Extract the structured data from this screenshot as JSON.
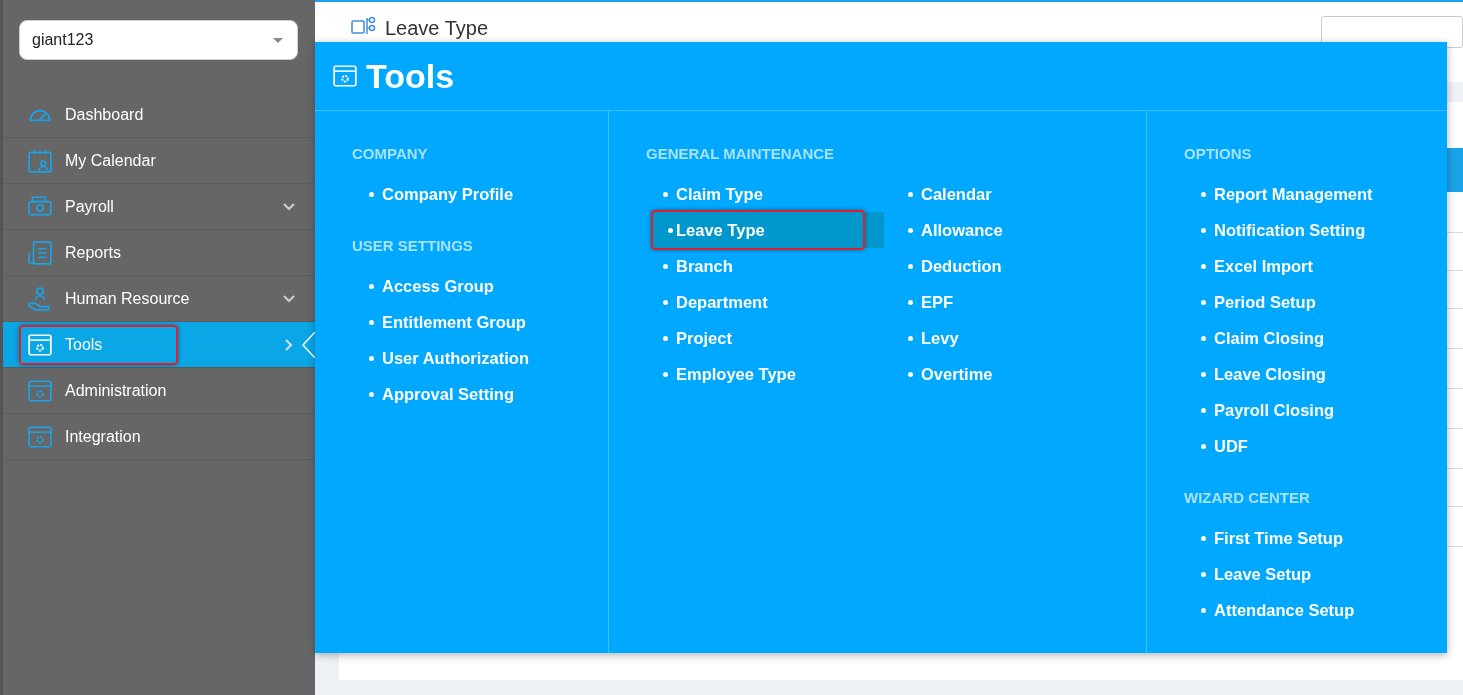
{
  "company_select": {
    "value": "giant123"
  },
  "sidebar": {
    "items": [
      {
        "label": "Dashboard",
        "expandable": false,
        "selected": false,
        "highlighted": false
      },
      {
        "label": "My Calendar",
        "expandable": false,
        "selected": false,
        "highlighted": false
      },
      {
        "label": "Payroll",
        "expandable": true,
        "selected": false,
        "highlighted": false
      },
      {
        "label": "Reports",
        "expandable": false,
        "selected": false,
        "highlighted": false
      },
      {
        "label": "Human Resource",
        "expandable": true,
        "selected": false,
        "highlighted": false
      },
      {
        "label": "Tools",
        "expandable": false,
        "selected": true,
        "highlighted": true
      },
      {
        "label": "Administration",
        "expandable": false,
        "selected": false,
        "highlighted": false
      },
      {
        "label": "Integration",
        "expandable": false,
        "selected": false,
        "highlighted": false
      }
    ]
  },
  "page": {
    "title": "Leave Type"
  },
  "menu": {
    "title": "Tools",
    "columns": [
      {
        "sections": [
          {
            "heading": "COMPANY",
            "lists": [
              [
                {
                  "label": "Company Profile",
                  "selected": false,
                  "highlighted": false
                }
              ]
            ]
          },
          {
            "heading": "USER SETTINGS",
            "lists": [
              [
                {
                  "label": "Access Group",
                  "selected": false,
                  "highlighted": false
                },
                {
                  "label": "Entitlement Group",
                  "selected": false,
                  "highlighted": false
                },
                {
                  "label": "User Authorization",
                  "selected": false,
                  "highlighted": false
                },
                {
                  "label": "Approval Setting",
                  "selected": false,
                  "highlighted": false
                }
              ]
            ]
          }
        ]
      },
      {
        "sections": [
          {
            "heading": "GENERAL MAINTENANCE",
            "lists": [
              [
                {
                  "label": "Claim Type",
                  "selected": false,
                  "highlighted": false
                },
                {
                  "label": "Leave Type",
                  "selected": true,
                  "highlighted": true
                },
                {
                  "label": "Branch",
                  "selected": false,
                  "highlighted": false
                },
                {
                  "label": "Department",
                  "selected": false,
                  "highlighted": false
                },
                {
                  "label": "Project",
                  "selected": false,
                  "highlighted": false
                },
                {
                  "label": "Employee Type",
                  "selected": false,
                  "highlighted": false
                }
              ],
              [
                {
                  "label": "Calendar",
                  "selected": false,
                  "highlighted": false
                },
                {
                  "label": "Allowance",
                  "selected": false,
                  "highlighted": false
                },
                {
                  "label": "Deduction",
                  "selected": false,
                  "highlighted": false
                },
                {
                  "label": "EPF",
                  "selected": false,
                  "highlighted": false
                },
                {
                  "label": "Levy",
                  "selected": false,
                  "highlighted": false
                },
                {
                  "label": "Overtime",
                  "selected": false,
                  "highlighted": false
                }
              ]
            ]
          }
        ]
      },
      {
        "sections": [
          {
            "heading": "OPTIONS",
            "lists": [
              [
                {
                  "label": "Report Management",
                  "selected": false,
                  "highlighted": false
                },
                {
                  "label": "Notification Setting",
                  "selected": false,
                  "highlighted": false
                },
                {
                  "label": "Excel Import",
                  "selected": false,
                  "highlighted": false
                },
                {
                  "label": "Period Setup",
                  "selected": false,
                  "highlighted": false
                },
                {
                  "label": "Claim Closing",
                  "selected": false,
                  "highlighted": false
                },
                {
                  "label": "Leave Closing",
                  "selected": false,
                  "highlighted": false
                },
                {
                  "label": "Payroll Closing",
                  "selected": false,
                  "highlighted": false
                },
                {
                  "label": "UDF",
                  "selected": false,
                  "highlighted": false
                }
              ]
            ]
          },
          {
            "heading": "WIZARD CENTER",
            "lists": [
              [
                {
                  "label": "First Time Setup",
                  "selected": false,
                  "highlighted": false
                },
                {
                  "label": "Leave Setup",
                  "selected": false,
                  "highlighted": false
                },
                {
                  "label": "Attendance Setup",
                  "selected": false,
                  "highlighted": false
                }
              ]
            ]
          }
        ]
      }
    ]
  }
}
